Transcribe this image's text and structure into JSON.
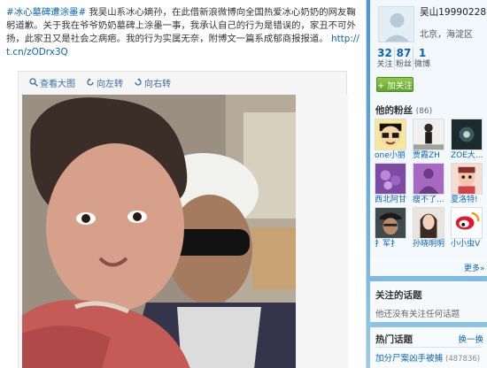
{
  "post": {
    "hashtag": "#冰心墓碑遭涂墨#",
    "body": " 我吴山系冰心嫡孙，在此借新浪微博向全国热爱冰心奶奶的网友鞠躬道歉。关于我在爷爷奶奶墓碑上涂墨一事，我承认自己的行为是错误的，家丑不可外扬，此家丑又是社会之病疤。我的行为实属无奈，附博文一篇系成郁商报报道。",
    "link": "http://t.cn/zODrx3Q"
  },
  "media_toolbar": {
    "view_large": "查看大图",
    "rotate_left": "向左转",
    "rotate_right": "向右转"
  },
  "profile": {
    "username": "吴山19990228",
    "location": "北京，海淀区",
    "following_count": "32",
    "following_label": "关注",
    "fans_count": "87",
    "fans_label": "粉丝",
    "weibo_count": "1",
    "weibo_label": "微博",
    "follow_button": "+ 加关注"
  },
  "fans_section": {
    "title": "他的粉丝",
    "count": "(86)",
    "fans": [
      {
        "name": "one小丽",
        "icon": "cartoon-face-avatar"
      },
      {
        "name": "贾霞ZH",
        "icon": "person-outdoor-avatar"
      },
      {
        "name": "ZOE大...",
        "icon": "dark-flower-avatar"
      },
      {
        "name": "西北阿甘",
        "icon": "purple-flower-avatar"
      },
      {
        "name": "瘦不了...",
        "icon": "purple-silhouette-avatar"
      },
      {
        "name": "夏洛特!",
        "icon": "doll-avatar"
      },
      {
        "name": "扌军扌",
        "icon": "pirate-avatar"
      },
      {
        "name": "孙晓明明",
        "icon": "portrait-avatar"
      },
      {
        "name": "小小虫V",
        "icon": "weibo-logo-avatar"
      }
    ],
    "more": "更多»"
  },
  "topics": {
    "title": "关注的话题",
    "empty_text": "他还没有关注任何话题"
  },
  "hot_topics": {
    "title": "热门话题",
    "switch": "换一换",
    "items": [
      {
        "name": "加分尸案凶手被捕",
        "count": "(487836)"
      }
    ]
  },
  "colors": {
    "link": "#0a64b5",
    "follow_button": "#5ea52a",
    "background": "#5d9ed1"
  }
}
